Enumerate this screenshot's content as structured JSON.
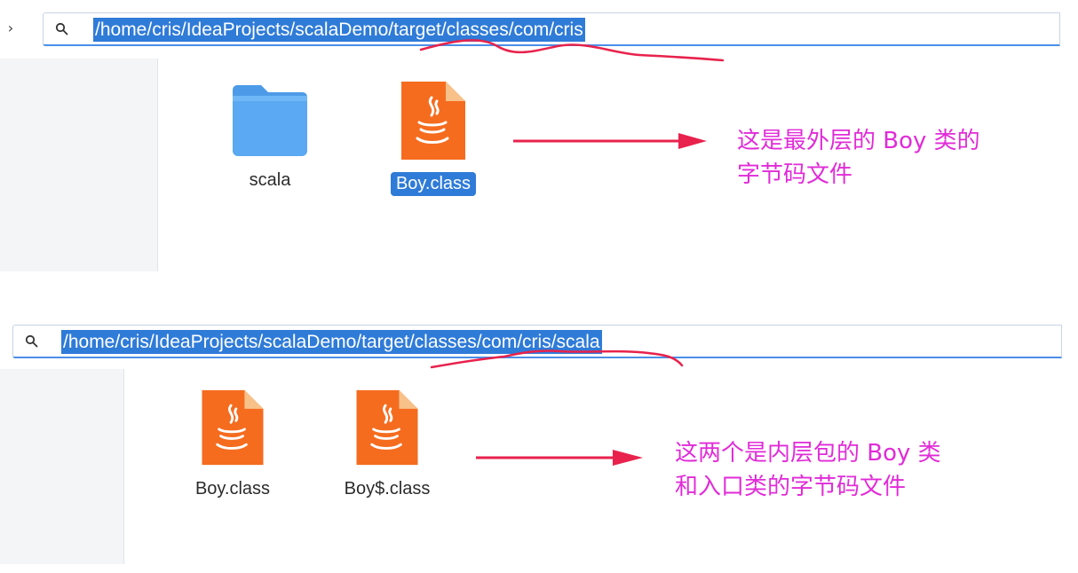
{
  "top_window": {
    "nav_arrow": "›",
    "path": "/home/cris/IdeaProjects/scalaDemo/target/classes/com/cris",
    "files": [
      {
        "name": "scala",
        "type": "folder",
        "selected": false
      },
      {
        "name": "Boy.class",
        "type": "java-class",
        "selected": true
      }
    ],
    "annotation": "这是最外层的 Boy 类的\n字节码文件"
  },
  "bottom_window": {
    "path": "/home/cris/IdeaProjects/scalaDemo/target/classes/com/cris/scala",
    "files": [
      {
        "name": "Boy.class",
        "type": "java-class",
        "selected": false
      },
      {
        "name": "Boy$.class",
        "type": "java-class",
        "selected": false
      }
    ],
    "annotation": "这两个是内层包的 Boy 类\n和入口类的字节码文件"
  },
  "colors": {
    "selection": "#2f7bd8",
    "annotation": "#e12bd8",
    "arrow": "#e8224c",
    "folder": "#5aa9f2",
    "java_file": "#f56c1f"
  },
  "icons": {
    "search": "search-icon",
    "folder": "folder-icon",
    "java_file": "java-file-icon"
  }
}
